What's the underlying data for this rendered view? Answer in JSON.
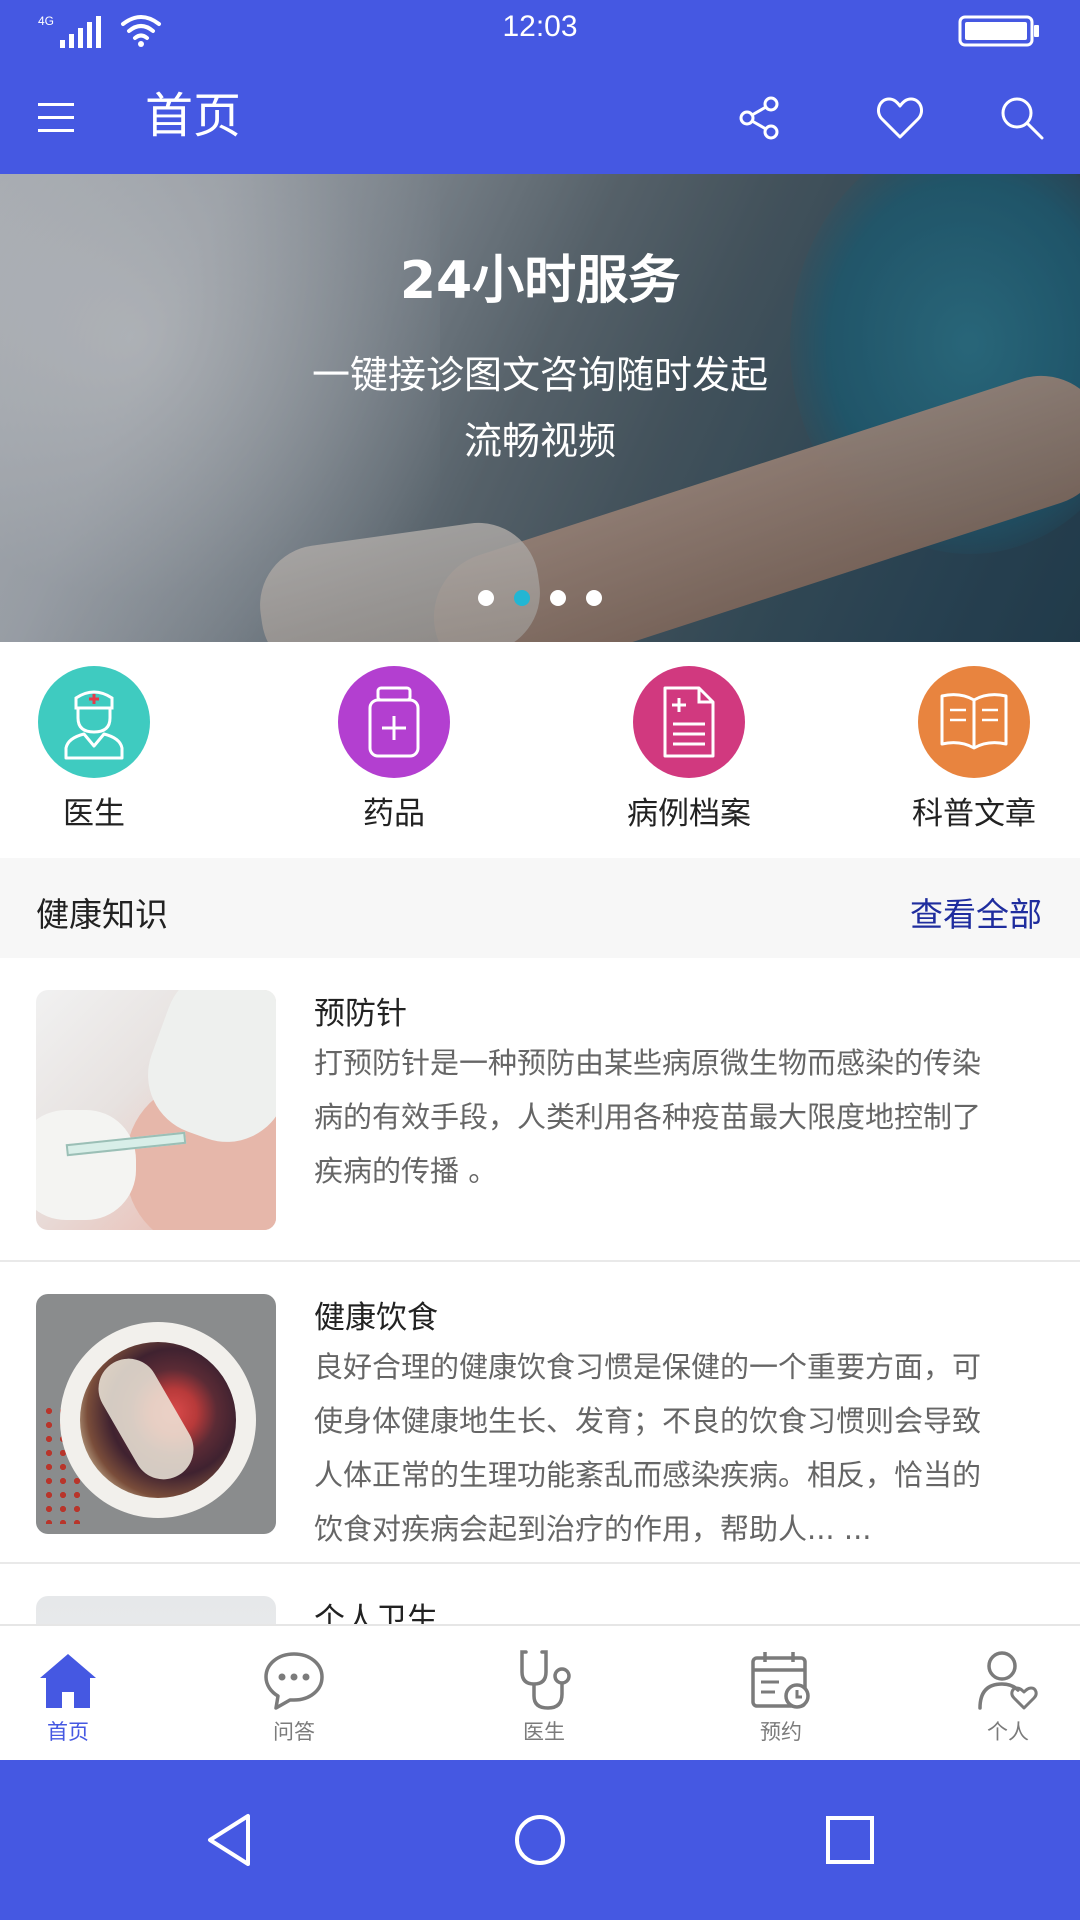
{
  "status_bar": {
    "network": "4G",
    "time": "12:03"
  },
  "header": {
    "title": "首页",
    "icons": [
      "menu-icon",
      "share-icon",
      "heart-icon",
      "search-icon"
    ]
  },
  "banner": {
    "title": "24小时服务",
    "line1": "一键接诊图文咨询随时发起",
    "line2": "流畅视频",
    "slide_count": 4,
    "active_slide_index": 1
  },
  "quick_links": [
    {
      "label": "医生",
      "icon": "nurse-icon",
      "color": "#3fcbc0"
    },
    {
      "label": "药品",
      "icon": "medicine-bottle-icon",
      "color": "#b33fd0"
    },
    {
      "label": "病例档案",
      "icon": "medical-record-icon",
      "color": "#d1397f"
    },
    {
      "label": "科普文章",
      "icon": "book-icon",
      "color": "#e8843f"
    }
  ],
  "section": {
    "title": "健康知识",
    "more": "查看全部"
  },
  "articles": [
    {
      "title": "预防针",
      "text": "打预防针是一种预防由某些病原微生物而感染的传染病的有效手段，人类利用各种疫苗最大限度地控制了疾病的传播 。",
      "image": "vaccination-photo"
    },
    {
      "title": "健康饮食",
      "text": "良好合理的健康饮食习惯是保健的一个重要方面，可使身体健康地生长、发育；不良的饮食习惯则会导致人体正常的生理功能紊乱而感染疾病。相反，恰当的饮食对疾病会起到治疗的作用，帮助人... ...",
      "image": "fruit-bowl-photo"
    },
    {
      "title": "个人卫生",
      "text": "",
      "image": "hygiene-photo"
    }
  ],
  "tabs": [
    {
      "label": "首页",
      "icon": "home-icon",
      "active": true
    },
    {
      "label": "问答",
      "icon": "chat-bubble-icon",
      "active": false
    },
    {
      "label": "医生",
      "icon": "stethoscope-icon",
      "active": false
    },
    {
      "label": "预约",
      "icon": "calendar-clock-icon",
      "active": false
    },
    {
      "label": "个人",
      "icon": "user-heart-icon",
      "active": false
    }
  ],
  "colors": {
    "primary": "#4558e2",
    "tab_active": "#4558e2",
    "tab_inactive": "#7b7b7b",
    "link": "#1f2d9e",
    "banner_dot_active": "#22b6d3"
  }
}
